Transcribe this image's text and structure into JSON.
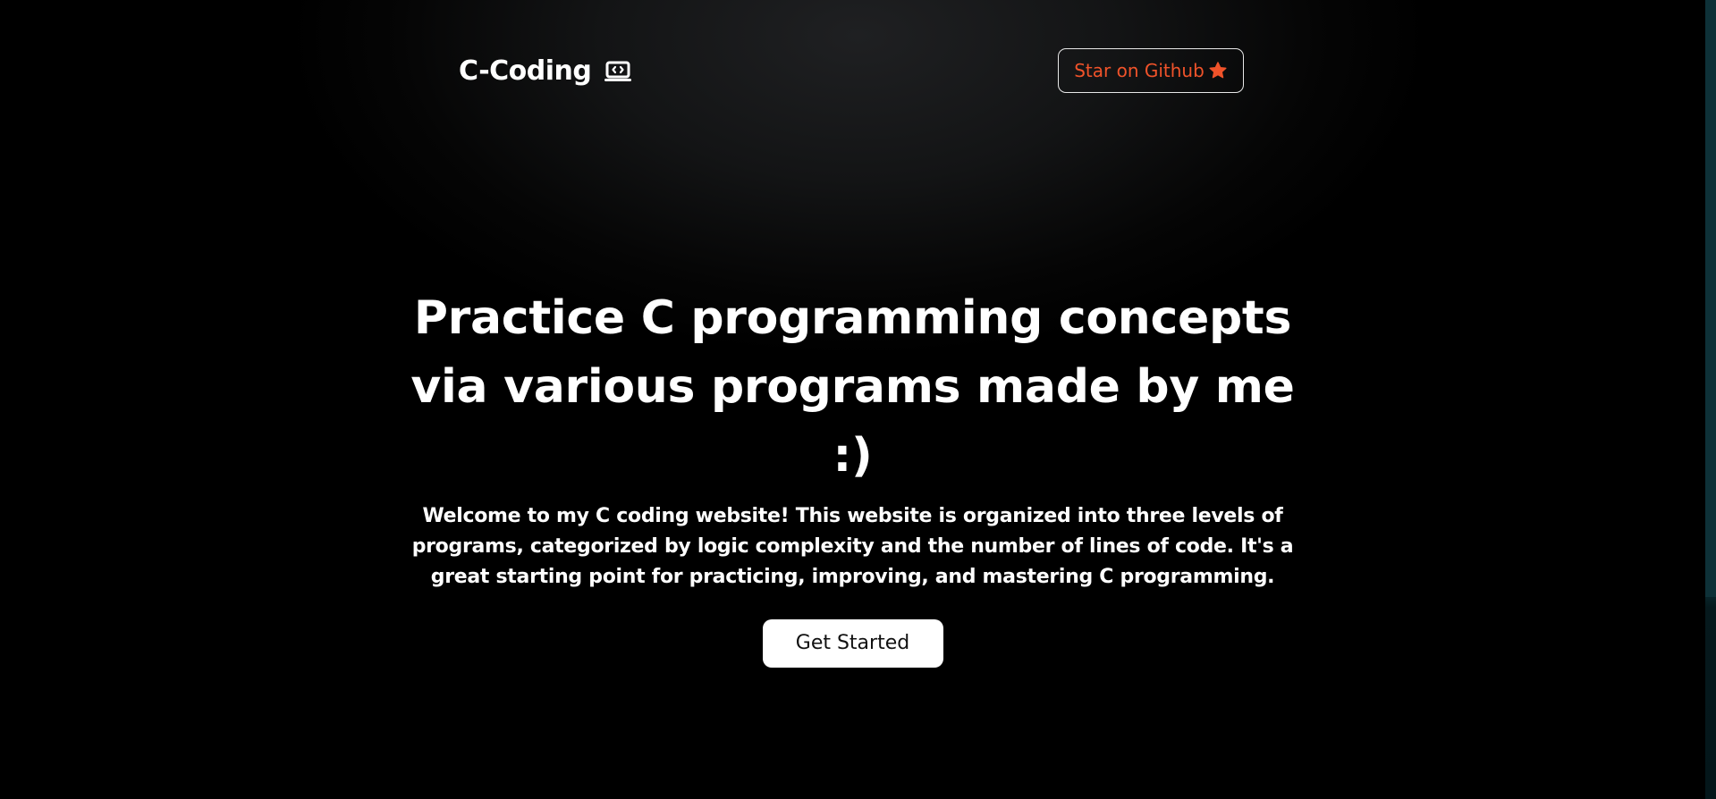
{
  "nav": {
    "brand": "C-Coding",
    "brand_icon": "laptop-code-icon",
    "github_label": "Star on Github",
    "github_icon": "star-icon",
    "accent": "#f0532a"
  },
  "hero": {
    "title_line1": "Practice C programming concepts",
    "title_line2": "via various programs made by me :)",
    "description": "Welcome to my C coding website! This website is organized into three levels of programs, categorized by logic complexity and the number of lines of code. It's a great starting point for practicing, improving, and mastering C programming.",
    "cta_label": "Get Started"
  }
}
